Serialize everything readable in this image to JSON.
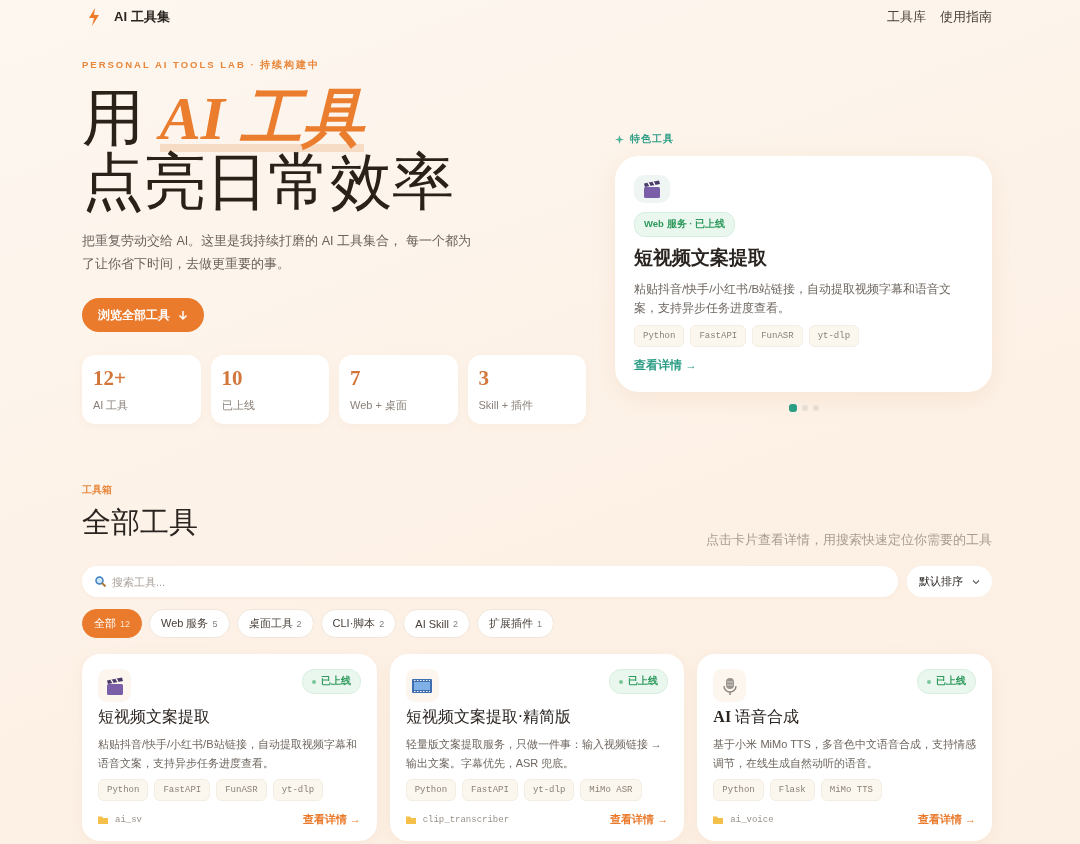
{
  "nav": {
    "brand": "AI 工具集",
    "links": [
      "工具库",
      "使用指南"
    ]
  },
  "hero": {
    "eyebrow": "PERSONAL AI TOOLS LAB · 持续构建中",
    "headline": [
      "用 *AI 工具*",
      "点亮日常效率"
    ],
    "intro": "把重复劳动交给 AI。这里是我持续打磨的 AI 工具集合， 每一个都为了让你省下时间，去做更重要的事。",
    "cta": "浏览全部工具",
    "stats": [
      {
        "value": "12+",
        "label": "AI 工具"
      },
      {
        "value": "10",
        "label": "已上线"
      },
      {
        "value": "7",
        "label": "Web + 桌面"
      },
      {
        "value": "3",
        "label": "Skill + 插件"
      }
    ]
  },
  "featured": {
    "label": "特色工具",
    "card": {
      "kind": "clapper",
      "badge": "Web 服务 · 已上线",
      "title": "短视频文案提取",
      "description": "粘贴抖音/快手/小红书/B站链接，自动提取视频字幕和语音文案，支持异步任务进度查看。",
      "tags": [
        "Python",
        "FastAPI",
        "FunASR",
        "yt-dlp"
      ],
      "link": "查看详情 →"
    },
    "dots": [
      {
        "selected": true
      },
      {
        "selected": false
      },
      {
        "selected": false
      }
    ]
  },
  "tools": {
    "eyebrow": "工具箱",
    "title": "全部工具",
    "hint": "点击卡片查看详情，用搜索快速定位你需要的工具",
    "search": {
      "placeholder": "搜索工具..."
    },
    "sort": "默认排序",
    "filters": [
      {
        "label": "全部",
        "count": "12",
        "selected": true
      },
      {
        "label": "Web 服务",
        "count": "5",
        "selected": false
      },
      {
        "label": "桌面工具",
        "count": "2",
        "selected": false
      },
      {
        "label": "CLI·脚本",
        "count": "2",
        "selected": false
      },
      {
        "label": "AI Skill",
        "count": "2",
        "selected": false
      },
      {
        "label": "扩展插件",
        "count": "1",
        "selected": false
      }
    ],
    "cards": [
      {
        "kind": "clapper",
        "status": "已上线",
        "title": "短视频文案提取",
        "description": "粘贴抖音/快手/小红书/B站链接，自动提取视频字幕和语音文案，支持异步任务进度查看。",
        "tags": [
          "Python",
          "FastAPI",
          "FunASR",
          "yt-dlp"
        ],
        "folder": "ai_sv",
        "link": "查看详情 →"
      },
      {
        "kind": "film",
        "status": "已上线",
        "title": "短视频文案提取·精简版",
        "description": "轻量版文案提取服务，只做一件事：输入视频链接 → 输出文案。字幕优先，ASR 兜底。",
        "tags": [
          "Python",
          "FastAPI",
          "yt-dlp",
          "MiMo ASR"
        ],
        "folder": "clip_transcriber",
        "link": "查看详情 →"
      },
      {
        "kind": "microphone",
        "status": "已上线",
        "title": "**AI** 语音合成",
        "description": "基于小米 MiMo TTS，多音色中文语音合成，支持情感调节，在线生成自然动听的语音。",
        "tags": [
          "Python",
          "Flask",
          "MiMo TTS"
        ],
        "folder": "ai_voice",
        "link": "查看详情 →"
      }
    ]
  }
}
